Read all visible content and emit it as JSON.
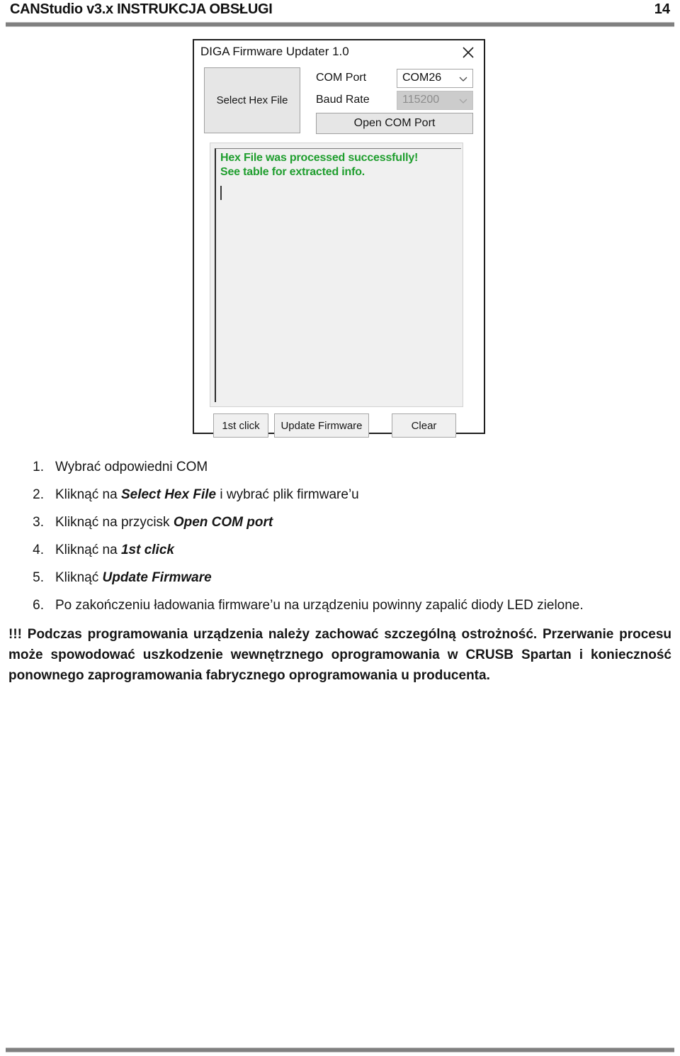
{
  "page": {
    "header_title": "CANStudio v3.x  INSTRUKCJA OBSŁUGI",
    "page_number": "14"
  },
  "app_window": {
    "title": "DIGA Firmware Updater 1.0",
    "close_icon": "close-icon",
    "select_hex_file_label": "Select Hex File",
    "com_port_label": "COM Port",
    "baud_rate_label": "Baud Rate",
    "com_port_value": "COM26",
    "baud_rate_value": "115200",
    "dropdown_icon": "chevron-down-icon",
    "open_com_port_label": "Open COM Port",
    "log_message": "Hex File was processed successfully! See table for extracted info.",
    "log_message_color": "#1f9e2e",
    "buttons": {
      "first_click": "1st click",
      "update_firmware": "Update Firmware",
      "clear": "Clear"
    }
  },
  "steps": [
    {
      "num": "1.",
      "html": "Wybrać odpowiedni COM",
      "text": "Wybrać odpowiedni COM"
    },
    {
      "num": "2.",
      "html": "Kliknąć na <b>Select Hex File</b> i wybrać plik firmware’u",
      "text": "Kliknąć na Select Hex File i wybrać plik firmware’u"
    },
    {
      "num": "3.",
      "html": "Kliknąć na przycisk <b>Open COM port</b>",
      "text": "Kliknąć na przycisk Open COM port"
    },
    {
      "num": "4.",
      "html": "Kliknąć na <b>1st click</b>",
      "text": "Kliknąć na 1st click"
    },
    {
      "num": "5.",
      "html": "Kliknąć <b>Update Firmware</b>",
      "text": "Kliknąć Update Firmware"
    },
    {
      "num": "6.",
      "html": "Po zakończeniu ładowania firmware’u na urządzeniu powinny zapalić diody LED zielone.",
      "text": "Po zakończeniu ładowania firmware’u na urządzeniu powinny zapalić diody LED zielone."
    }
  ],
  "warning": {
    "text": "!!! Podczas programowania urządzenia należy zachować szczególną ostrożność. Przerwanie procesu może spowodować uszkodzenie wewnętrznego oprogramowania w CRUSB Spartan i konieczność ponownego zaprogramowania fabrycznego oprogramowania u producenta."
  }
}
